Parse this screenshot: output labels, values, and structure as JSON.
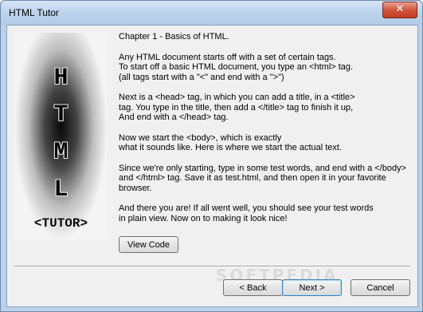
{
  "window": {
    "title": "HTML Tutor",
    "close_glyph": "✕"
  },
  "logo": {
    "letters": [
      "H",
      "T",
      "M",
      "L"
    ],
    "subtitle": "<TUTOR>"
  },
  "content": {
    "paragraphs": [
      "Chapter 1 - Basics of HTML.",
      "Any HTML document starts off with a set of certain tags.\nTo start off a basic HTML document, you type an <html> tag.\n(all tags start with a \"<\" and end with a \">\")",
      "Next is a <head> tag, in which you can add a title, in a <title>\ntag. You type in the title, then add a </title> tag to finish it up,\nAnd end with a </head> tag.",
      " Now we start the <body>, which is exactly\nwhat it sounds like. Here is where we start the actual text.",
      "Since we're only starting, type in some test words, and end with a </body>\nand </html> tag. Save it as test.html, and then open it in your favorite\nbrowser.",
      "And there you are! If all went well, you should see your test words\nin plain view. Now on to making it look nice!"
    ]
  },
  "buttons": {
    "view_code": "View Code",
    "back": "< Back",
    "next": "Next >",
    "cancel": "Cancel"
  },
  "watermark": "SOFTPEDIA"
}
